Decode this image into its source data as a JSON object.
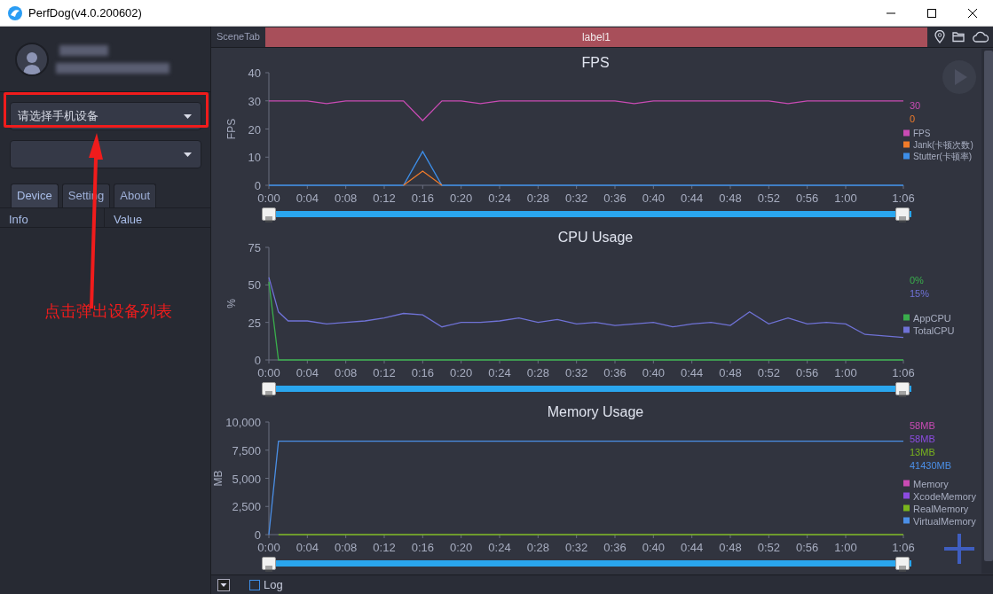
{
  "window": {
    "title": "PerfDog(v4.0.200602)"
  },
  "sidebar": {
    "device_select": {
      "value": "请选择手机设备"
    },
    "tabs": [
      {
        "label": "Device",
        "selected": true
      },
      {
        "label": "Setting",
        "selected": false
      },
      {
        "label": "About",
        "selected": false
      }
    ],
    "table": {
      "columns": [
        "Info",
        "Value"
      ]
    }
  },
  "annotation": {
    "text": "点击弹出设备列表"
  },
  "scene_bar": {
    "label": "SceneTab",
    "scene": "label1"
  },
  "charts": [
    {
      "readings": [
        "30",
        "0"
      ],
      "chart_data": {
        "type": "line",
        "title": "FPS",
        "ylabel": "FPS",
        "x": [
          0,
          1,
          2,
          4,
          6,
          8,
          10,
          12,
          14,
          16,
          18,
          20,
          22,
          24,
          26,
          28,
          30,
          32,
          34,
          36,
          38,
          40,
          42,
          44,
          46,
          48,
          50,
          52,
          54,
          56,
          58,
          60,
          62,
          64,
          66
        ],
        "xlim": [
          0,
          66
        ],
        "ylim": [
          0,
          40
        ],
        "yticks": [
          {
            "value": 0,
            "label": "0"
          },
          {
            "value": 10,
            "label": "10"
          },
          {
            "value": 20,
            "label": "20"
          },
          {
            "value": 30,
            "label": "30"
          },
          {
            "value": 40,
            "label": "40"
          }
        ],
        "xticks": [
          {
            "value": 0,
            "label": "0:00"
          },
          {
            "value": 4,
            "label": "0:04"
          },
          {
            "value": 8,
            "label": "0:08"
          },
          {
            "value": 12,
            "label": "0:12"
          },
          {
            "value": 16,
            "label": "0:16"
          },
          {
            "value": 20,
            "label": "0:20"
          },
          {
            "value": 24,
            "label": "0:24"
          },
          {
            "value": 28,
            "label": "0:28"
          },
          {
            "value": 32,
            "label": "0:32"
          },
          {
            "value": 36,
            "label": "0:36"
          },
          {
            "value": 40,
            "label": "0:40"
          },
          {
            "value": 44,
            "label": "0:44"
          },
          {
            "value": 48,
            "label": "0:48"
          },
          {
            "value": 52,
            "label": "0:52"
          },
          {
            "value": 56,
            "label": "0:56"
          },
          {
            "value": 60,
            "label": "1:00"
          },
          {
            "value": 66,
            "label": "1:06"
          }
        ],
        "legend": true,
        "series": [
          {
            "name": "FPS",
            "color": "#c94bb4",
            "values": [
              30,
              30,
              30,
              30,
              29,
              30,
              30,
              30,
              30,
              23,
              30,
              30,
              29,
              30,
              30,
              30,
              30,
              30,
              30,
              30,
              29,
              30,
              30,
              30,
              30,
              30,
              30,
              30,
              29,
              30,
              30,
              30,
              30,
              30,
              30
            ]
          },
          {
            "name": "Jank(卡顿次数)",
            "color": "#f07b2a",
            "values": [
              null,
              null,
              null,
              null,
              null,
              null,
              null,
              null,
              0,
              5,
              0,
              null,
              null,
              null,
              null,
              null,
              null,
              null,
              null,
              null,
              null,
              null,
              null,
              null,
              null,
              null,
              null,
              null,
              null,
              null,
              null,
              null,
              null,
              null,
              null
            ]
          },
          {
            "name": "Stutter(卡顿率)",
            "color": "#3d8ee8",
            "values": [
              0,
              0,
              0,
              0,
              0,
              0,
              0,
              0,
              0,
              12,
              0,
              0,
              0,
              0,
              0,
              0,
              0,
              0,
              0,
              0,
              0,
              0,
              0,
              0,
              0,
              0,
              0,
              0,
              0,
              0,
              0,
              0,
              0,
              0,
              0
            ]
          }
        ]
      }
    },
    {
      "readings": [
        "0%",
        "15%"
      ],
      "chart_data": {
        "type": "line",
        "title": "CPU Usage",
        "ylabel": "%",
        "x": [
          0,
          1,
          2,
          4,
          6,
          8,
          10,
          12,
          14,
          16,
          18,
          20,
          22,
          24,
          26,
          28,
          30,
          32,
          34,
          36,
          38,
          40,
          42,
          44,
          46,
          48,
          50,
          52,
          54,
          56,
          58,
          60,
          62,
          64,
          66
        ],
        "xlim": [
          0,
          66
        ],
        "ylim": [
          0,
          75
        ],
        "yticks": [
          {
            "value": 0,
            "label": "0"
          },
          {
            "value": 25,
            "label": "25"
          },
          {
            "value": 50,
            "label": "50"
          },
          {
            "value": 75,
            "label": "75"
          }
        ],
        "xticks": [
          {
            "value": 0,
            "label": "0:00"
          },
          {
            "value": 4,
            "label": "0:04"
          },
          {
            "value": 8,
            "label": "0:08"
          },
          {
            "value": 12,
            "label": "0:12"
          },
          {
            "value": 16,
            "label": "0:16"
          },
          {
            "value": 20,
            "label": "0:20"
          },
          {
            "value": 24,
            "label": "0:24"
          },
          {
            "value": 28,
            "label": "0:28"
          },
          {
            "value": 32,
            "label": "0:32"
          },
          {
            "value": 36,
            "label": "0:36"
          },
          {
            "value": 40,
            "label": "0:40"
          },
          {
            "value": 44,
            "label": "0:44"
          },
          {
            "value": 48,
            "label": "0:48"
          },
          {
            "value": 52,
            "label": "0:52"
          },
          {
            "value": 56,
            "label": "0:56"
          },
          {
            "value": 60,
            "label": "1:00"
          },
          {
            "value": 66,
            "label": "1:06"
          }
        ],
        "legend": true,
        "series": [
          {
            "name": "AppCPU",
            "color": "#3aae4c",
            "values": [
              52,
              0,
              0,
              0,
              0,
              0,
              0,
              0,
              0,
              0,
              0,
              0,
              0,
              0,
              0,
              0,
              0,
              0,
              0,
              0,
              0,
              0,
              0,
              0,
              0,
              0,
              0,
              0,
              0,
              0,
              0,
              0,
              0,
              0,
              0
            ]
          },
          {
            "name": "TotalCPU",
            "color": "#6f72d6",
            "values": [
              55,
              32,
              26,
              26,
              24,
              25,
              26,
              28,
              31,
              30,
              22,
              25,
              25,
              26,
              28,
              25,
              27,
              24,
              25,
              23,
              24,
              25,
              22,
              24,
              25,
              23,
              32,
              24,
              28,
              24,
              25,
              24,
              17,
              16,
              15
            ]
          }
        ]
      }
    },
    {
      "readings": [
        "58MB",
        "58MB",
        "13MB",
        "41430MB"
      ],
      "chart_data": {
        "type": "line",
        "title": "Memory Usage",
        "ylabel": "MB",
        "x": [
          0,
          1,
          2,
          4,
          6,
          8,
          10,
          12,
          14,
          16,
          18,
          20,
          22,
          24,
          26,
          28,
          30,
          32,
          34,
          36,
          38,
          40,
          42,
          44,
          46,
          48,
          50,
          52,
          54,
          56,
          58,
          60,
          62,
          64,
          66
        ],
        "xlim": [
          0,
          66
        ],
        "ylim": [
          0,
          10000
        ],
        "yticks": [
          {
            "value": 0,
            "label": "0"
          },
          {
            "value": 2500,
            "label": "2,500"
          },
          {
            "value": 5000,
            "label": "5,000"
          },
          {
            "value": 7500,
            "label": "7,500"
          },
          {
            "value": 10000,
            "label": "10,000"
          }
        ],
        "xticks": [
          {
            "value": 0,
            "label": "0:00"
          },
          {
            "value": 4,
            "label": "0:04"
          },
          {
            "value": 8,
            "label": "0:08"
          },
          {
            "value": 12,
            "label": "0:12"
          },
          {
            "value": 16,
            "label": "0:16"
          },
          {
            "value": 20,
            "label": "0:20"
          },
          {
            "value": 24,
            "label": "0:24"
          },
          {
            "value": 28,
            "label": "0:28"
          },
          {
            "value": 32,
            "label": "0:32"
          },
          {
            "value": 36,
            "label": "0:36"
          },
          {
            "value": 40,
            "label": "0:40"
          },
          {
            "value": 44,
            "label": "0:44"
          },
          {
            "value": 48,
            "label": "0:48"
          },
          {
            "value": 52,
            "label": "0:52"
          },
          {
            "value": 56,
            "label": "0:56"
          },
          {
            "value": 60,
            "label": "1:00"
          },
          {
            "value": 66,
            "label": "1:06"
          }
        ],
        "legend": true,
        "series": [
          {
            "name": "Memory",
            "color": "#c94bb4",
            "values": [
              null,
              null,
              null,
              null,
              null,
              null,
              null,
              null,
              null,
              null,
              null,
              null,
              null,
              null,
              null,
              null,
              null,
              null,
              null,
              null,
              null,
              null,
              null,
              null,
              null,
              null,
              null,
              null,
              null,
              null,
              null,
              null,
              null,
              null,
              null
            ]
          },
          {
            "name": "XcodeMemory",
            "color": "#8c4be0",
            "values": [
              null,
              null,
              null,
              null,
              null,
              null,
              null,
              null,
              null,
              null,
              null,
              null,
              null,
              null,
              null,
              null,
              null,
              null,
              null,
              null,
              null,
              null,
              null,
              null,
              null,
              null,
              null,
              null,
              null,
              null,
              null,
              null,
              null,
              null,
              null
            ]
          },
          {
            "name": "RealMemory",
            "color": "#7ab51d",
            "values": [
              null,
              0,
              0,
              0,
              0,
              0,
              0,
              0,
              0,
              0,
              0,
              0,
              0,
              0,
              0,
              0,
              0,
              0,
              0,
              0,
              0,
              0,
              0,
              0,
              0,
              0,
              0,
              0,
              0,
              0,
              0,
              0,
              0,
              0,
              0
            ]
          },
          {
            "name": "VirtualMemory",
            "color": "#4b8fe6",
            "values": [
              0,
              8300,
              8300,
              8300,
              8300,
              8300,
              8300,
              8300,
              8300,
              8300,
              8300,
              8300,
              8300,
              8300,
              8300,
              8300,
              8300,
              8300,
              8300,
              8300,
              8300,
              8300,
              8300,
              8300,
              8300,
              8300,
              8300,
              8300,
              8300,
              8300,
              8300,
              8300,
              8300,
              8300,
              8300
            ]
          }
        ]
      }
    }
  ],
  "sliders": [
    {
      "level": 1
    },
    {
      "level": 1
    },
    {
      "level": 1
    }
  ],
  "bottom_bar": {
    "log": {
      "label": "Log",
      "checked": false
    }
  }
}
